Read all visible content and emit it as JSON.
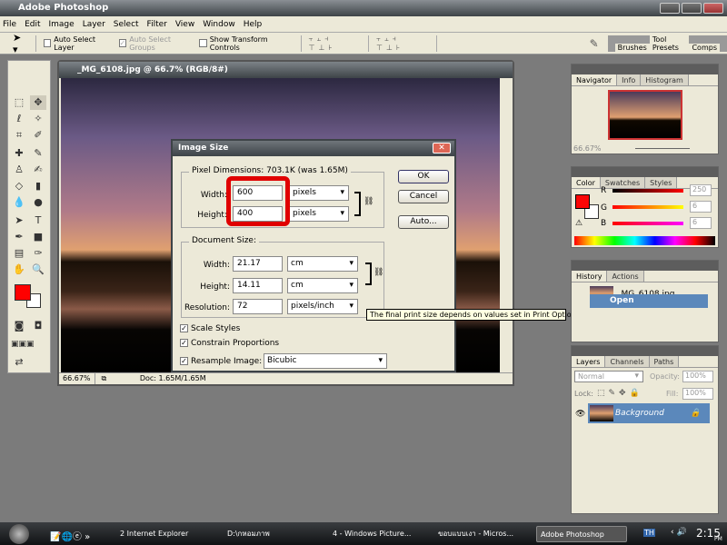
{
  "app": {
    "title": "Adobe Photoshop"
  },
  "menu": [
    "File",
    "Edit",
    "Image",
    "Layer",
    "Select",
    "Filter",
    "View",
    "Window",
    "Help"
  ],
  "options": {
    "auto_select_layer": "Auto Select Layer",
    "auto_select_groups": "Auto Select Groups",
    "show_transform": "Show Transform Controls",
    "well_tabs": [
      "Brushes",
      "Tool Presets",
      "Comps"
    ]
  },
  "toolbox": {
    "foreground": "#ff0000",
    "background": "#ffffff"
  },
  "document": {
    "title": "_MG_6108.jpg @ 66.7% (RGB/8#)",
    "zoom": "66.67%",
    "doc_info": "Doc: 1.65M/1.65M"
  },
  "dialog": {
    "title": "Image Size",
    "pixel_dimensions": "Pixel Dimensions:  703.1K (was 1.65M)",
    "px_width_label": "Width:",
    "px_width": "600",
    "px_width_unit": "pixels",
    "px_height_label": "Height:",
    "px_height": "400",
    "px_height_unit": "pixels",
    "document_size": "Document Size:",
    "doc_width_label": "Width:",
    "doc_width": "21.17",
    "doc_width_unit": "cm",
    "doc_height_label": "Height:",
    "doc_height": "14.11",
    "doc_height_unit": "cm",
    "resolution_label": "Resolution:",
    "resolution": "72",
    "resolution_unit": "pixels/inch",
    "scale_styles": "Scale Styles",
    "constrain": "Constrain Proportions",
    "resample": "Resample Image:",
    "resample_method": "Bicubic",
    "ok": "OK",
    "cancel": "Cancel",
    "auto": "Auto...",
    "highlight_color": "#e00000"
  },
  "tooltip": "The final print size depends on values set in Print Options",
  "navigator": {
    "tabs": [
      "Navigator",
      "Info",
      "Histogram"
    ],
    "zoom": "66.67%"
  },
  "color": {
    "tabs": [
      "Color",
      "Swatches",
      "Styles"
    ],
    "r_label": "R",
    "g_label": "G",
    "b_label": "B",
    "r": "250",
    "g": "6",
    "b": "6",
    "swatch": "#fa0606"
  },
  "history": {
    "tabs": [
      "History",
      "Actions"
    ],
    "snapshot": "_MG_6108.jpg",
    "items": [
      "Open"
    ]
  },
  "layers": {
    "tabs": [
      "Layers",
      "Channels",
      "Paths"
    ],
    "blend": "Normal",
    "opacity_label": "Opacity:",
    "opacity": "100%",
    "lock_label": "Lock:",
    "fill_label": "Fill:",
    "fill": "100%",
    "layer": "Background"
  },
  "taskbar": {
    "items": [
      "2 Internet Explorer",
      "D:\\กหอมภาพ",
      "4 - Windows Picture...",
      "ขอบแบบเงา - Micros...",
      "Adobe Photoshop"
    ],
    "lang": "TH",
    "time": "2:15",
    "ampm": "PM"
  }
}
